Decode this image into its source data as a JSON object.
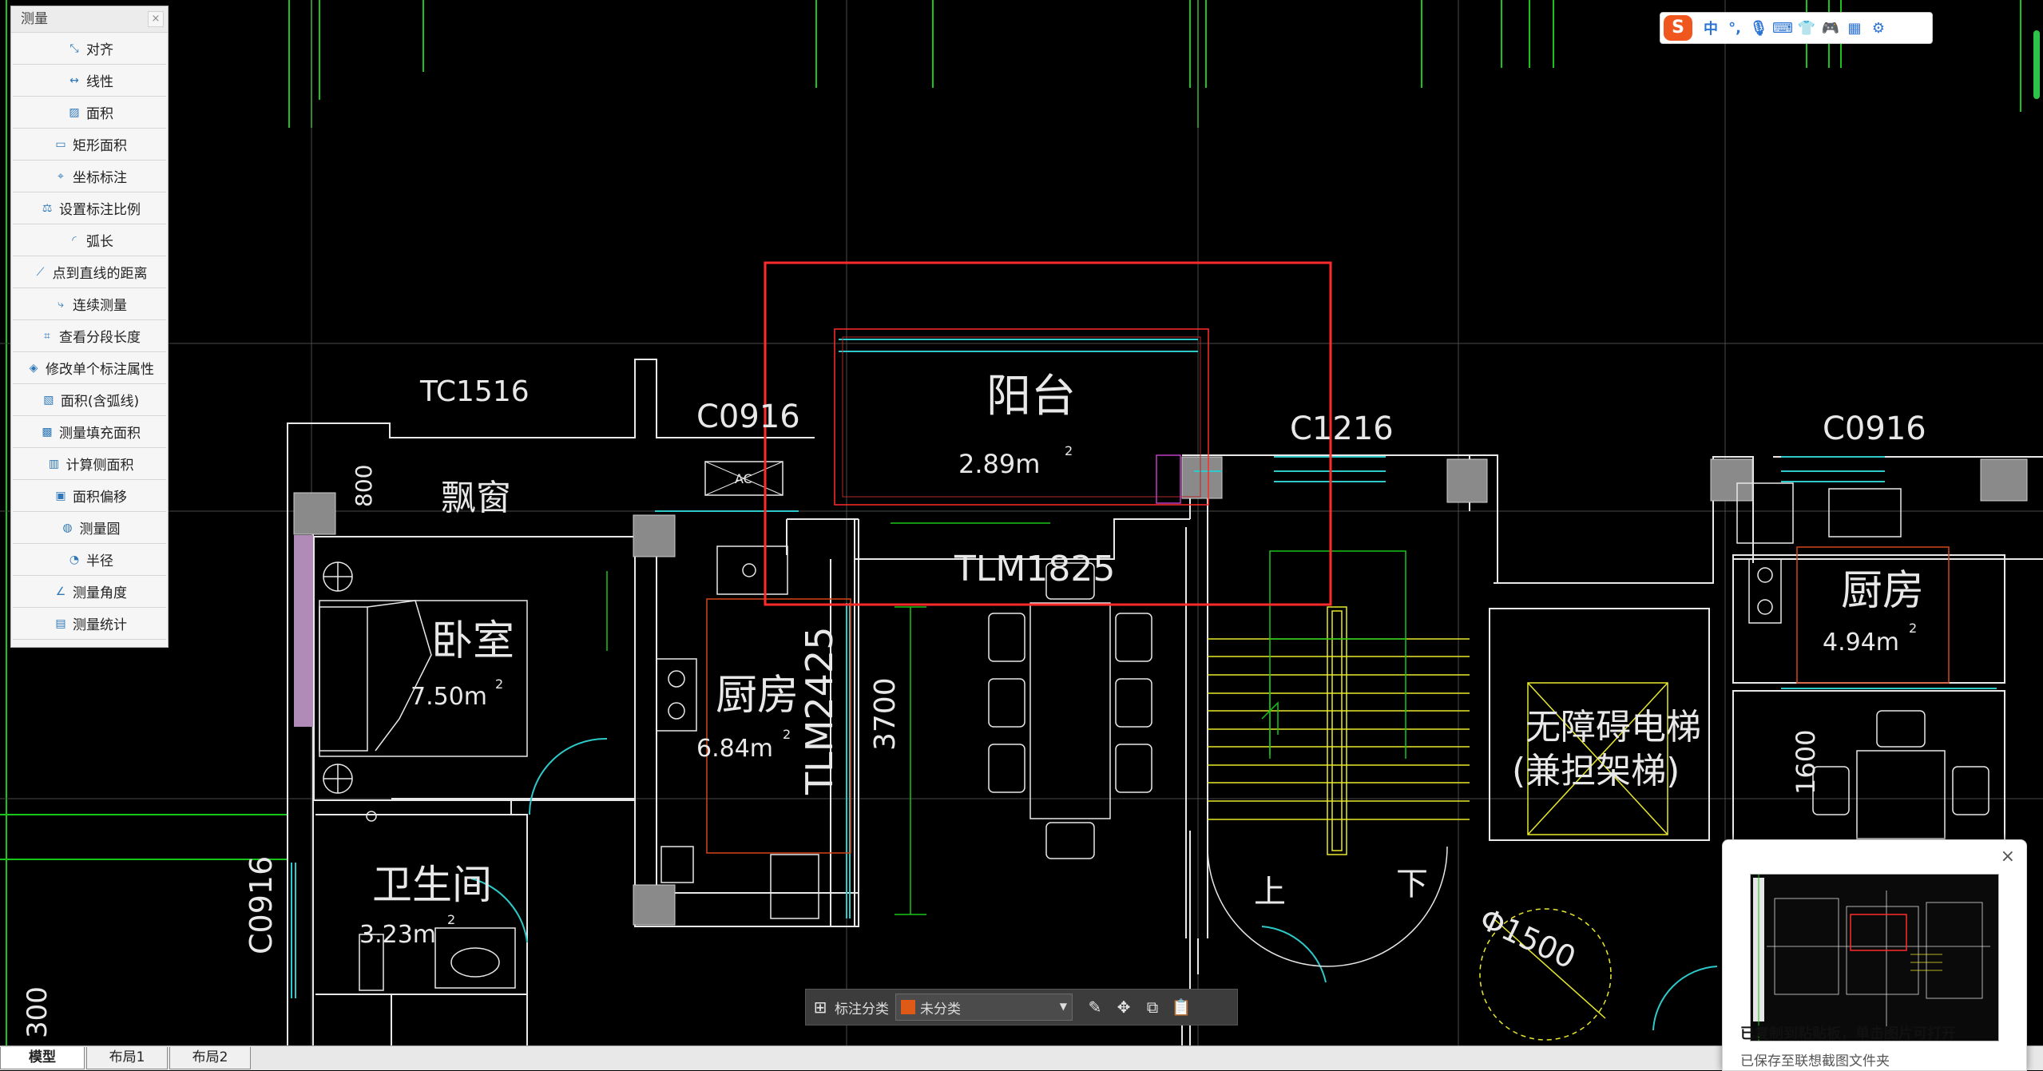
{
  "measure_panel": {
    "title": "测量",
    "close": "×",
    "tools": [
      {
        "label": "对齐",
        "icon": "align-icon"
      },
      {
        "label": "线性",
        "icon": "linear-dimension-icon"
      },
      {
        "label": "面积",
        "icon": "area-icon"
      },
      {
        "label": "矩形面积",
        "icon": "rect-area-icon"
      },
      {
        "label": "坐标标注",
        "icon": "coordinate-icon"
      },
      {
        "label": "设置标注比例",
        "icon": "scale-icon"
      },
      {
        "label": "弧长",
        "icon": "arc-length-icon"
      },
      {
        "label": "点到直线的距离",
        "icon": "point-line-distance-icon"
      },
      {
        "label": "连续测量",
        "icon": "continuous-measure-icon"
      },
      {
        "label": "查看分段长度",
        "icon": "segment-length-icon"
      },
      {
        "label": "修改单个标注属性",
        "icon": "edit-annotation-icon"
      },
      {
        "label": "面积(含弧线)",
        "icon": "arc-area-icon"
      },
      {
        "label": "测量填充面积",
        "icon": "fill-area-icon"
      },
      {
        "label": "计算侧面积",
        "icon": "side-area-icon"
      },
      {
        "label": "面积偏移",
        "icon": "area-offset-icon"
      },
      {
        "label": "测量圆",
        "icon": "circle-measure-icon"
      },
      {
        "label": "半径",
        "icon": "radius-icon"
      },
      {
        "label": "测量角度",
        "icon": "angle-icon"
      },
      {
        "label": "测量统计",
        "icon": "statistics-icon"
      }
    ]
  },
  "drawing": {
    "tc1516": "TC1516",
    "c0916_a": "C0916",
    "c1216": "C1216",
    "c0916_b": "C0916",
    "c0916_vert": "C0916",
    "balcony": "阳台",
    "balcony_area": "2.89m",
    "sup2": "2",
    "bay_window": "飘窗",
    "bay_800": "800",
    "ac": "AC",
    "tlm1825": "TLM1825",
    "bedroom": "卧室",
    "bedroom_area": "7.50m",
    "kitchen": "厨房",
    "kitchen_area": "6.84m",
    "tlm2425": "TLM2425",
    "dim_3700": "3700",
    "kitchen_right": "厨房",
    "kitchen_right_area": "4.94m",
    "elevator1": "无障碍电梯",
    "elevator2": "(兼担架梯)",
    "bathroom": "卫生间",
    "bathroom_area": "3.23m",
    "up": "上",
    "down": "下",
    "phi1500": "Φ1500",
    "dim_1600": "1600",
    "dim_300": "300"
  },
  "annotation_bar": {
    "label": "标注分类",
    "selected": "未分类",
    "category_color": "#e05a17"
  },
  "layout_tabs": [
    "模型",
    "布局1",
    "布局2"
  ],
  "ime": {
    "logo": "S",
    "lang": "中",
    "punct": "°,"
  },
  "toast": {
    "close": "×",
    "line1": "已复制到粘贴板，单击图片可打开",
    "line2": "已保存至联想截图文件夹"
  },
  "colors": {
    "wall": "#e8e8e8",
    "grid": "#19c419",
    "selection": "#ff2a2a",
    "window": "#2ec9c9",
    "stair": "#e8e82c"
  }
}
